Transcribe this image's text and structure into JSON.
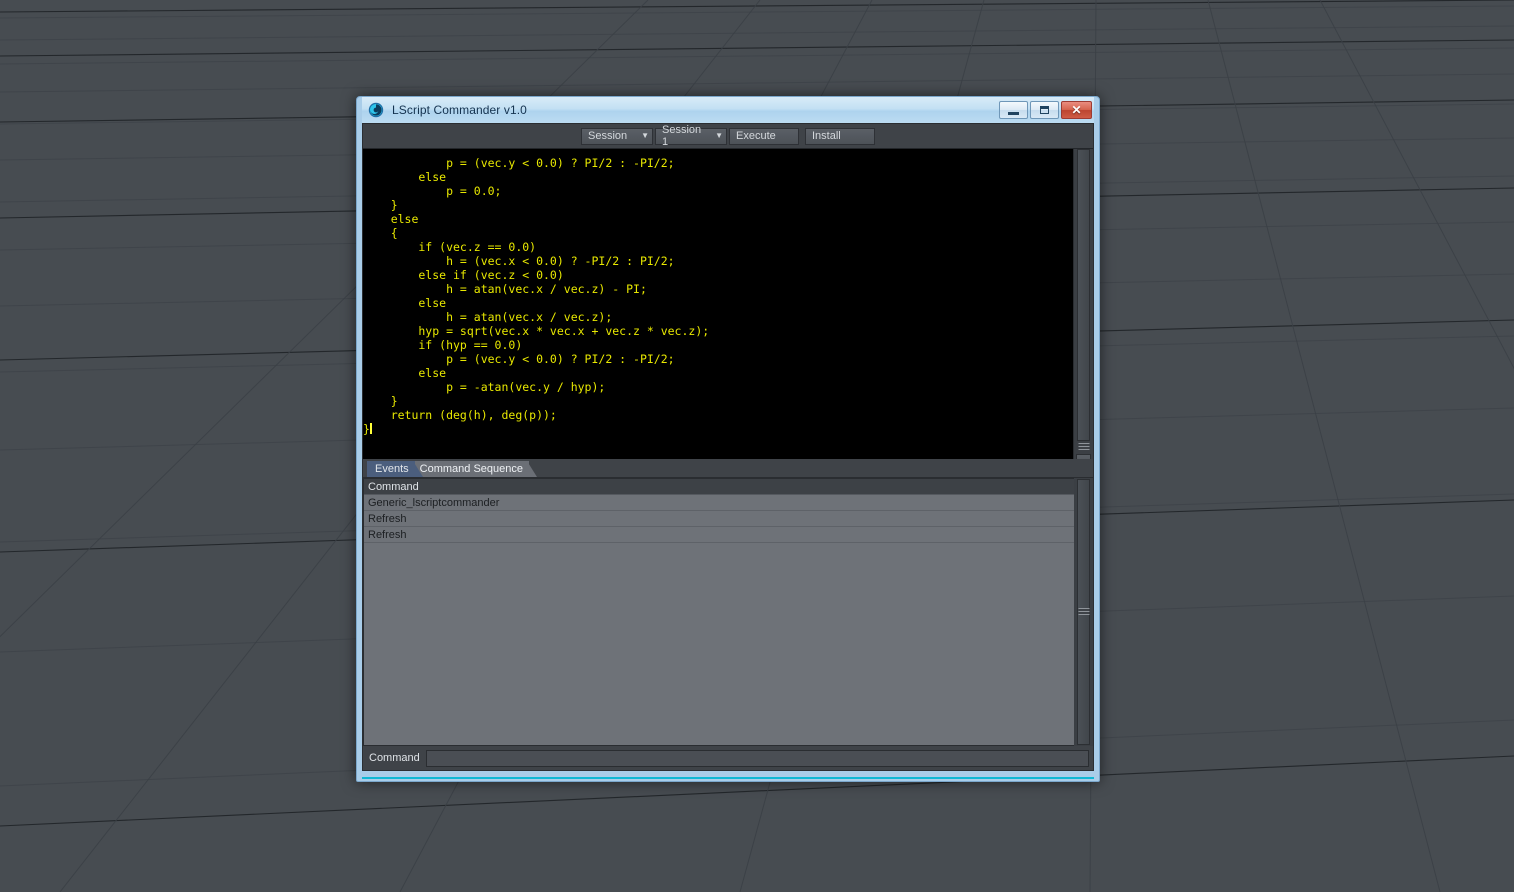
{
  "window": {
    "title": "LScript Commander v1.0",
    "icon": "swirl-app-icon",
    "controls": {
      "minimize": "–",
      "maximize": "□",
      "close": "✕"
    },
    "frame_color": "#a9cde9",
    "accent_color": "#0fb8d4"
  },
  "toolbar": {
    "session_label": "Session",
    "session_chevron": "▼",
    "session_number_label": "Session 1",
    "session_number_chevron": "▼",
    "execute_label": "Execute",
    "install_label": "Install"
  },
  "editor": {
    "background": "#000000",
    "text_color": "#e8e800",
    "lines": [
      "            p = (vec.y < 0.0) ? PI/2 : -PI/2;",
      "        else",
      "            p = 0.0;",
      "    }",
      "    else",
      "    {",
      "        if (vec.z == 0.0)",
      "            h = (vec.x < 0.0) ? -PI/2 : PI/2;",
      "        else if (vec.z < 0.0)",
      "            h = atan(vec.x / vec.z) - PI;",
      "        else",
      "            h = atan(vec.x / vec.z);",
      "        hyp = sqrt(vec.x * vec.x + vec.z * vec.z);",
      "        if (hyp == 0.0)",
      "            p = (vec.y < 0.0) ? PI/2 : -PI/2;",
      "        else",
      "            p = -atan(vec.y / hyp);",
      "    }",
      "",
      "    return (deg(h), deg(p));",
      "}"
    ],
    "scrollbar_arrow": "⌄"
  },
  "tabs": [
    {
      "label": "Events",
      "active": true
    },
    {
      "label": "Command Sequence",
      "active": false
    }
  ],
  "events_table": {
    "columns": [
      "Command"
    ],
    "rows": [
      [
        "Generic_lscriptcommander"
      ],
      [
        "Refresh"
      ],
      [
        "Refresh"
      ]
    ]
  },
  "command_bar": {
    "label": "Command",
    "value": "",
    "placeholder": ""
  },
  "background": {
    "type": "3d-perspective-grid-viewport",
    "base_color": "#474c51",
    "line_color": "#2a2e32"
  }
}
